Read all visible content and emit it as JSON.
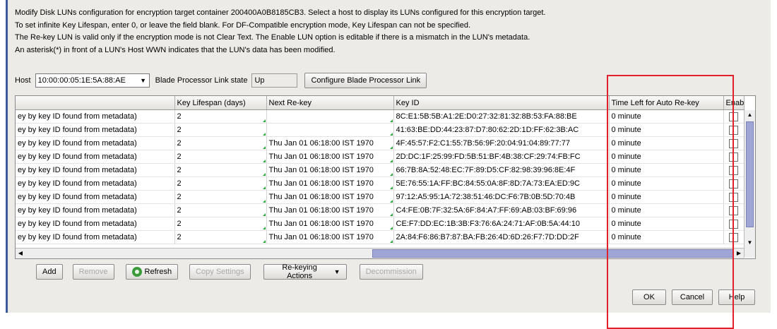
{
  "info_lines": [
    "Modify Disk LUNs configuration for encryption target container 200400A0B8185CB3. Select a host to display its LUNs configured for this encryption target.",
    "To set infinite Key Lifespan, enter 0, or leave the field blank. For DF-Compatible encryption mode, Key Lifespan can not be specified.",
    "The Re-key LUN is valid only if the encryption mode is not Clear Text. The Enable LUN option is editable if there is a mismatch in the LUN's metadata.",
    "An asterisk(*) in front of a LUN's Host WWN indicates that the LUN's data has been modified."
  ],
  "host": {
    "label": "Host",
    "value": "10:00:00:05:1E:5A:88:AE",
    "link_state_label": "Blade Processor Link state",
    "link_state_value": "Up",
    "configure_button": "Configure Blade Processor Link"
  },
  "table": {
    "columns": [
      "",
      "Key Lifespan (days)",
      "Next Re-key",
      "Key ID",
      "Time Left for Auto Re-key",
      "Enable"
    ],
    "rows": [
      {
        "c0": "ey by key ID found from metadata)",
        "c1": "2",
        "c2": "",
        "c3": "8C:E1:5B:5B:A1:2E:D0:27:32:81:32:8B:53:FA:88:BE",
        "c4": "0 minute"
      },
      {
        "c0": "ey by key ID found from metadata)",
        "c1": "2",
        "c2": "",
        "c3": "41:63:BE:DD:44:23:87:D7:80:62:2D:1D:FF:62:3B:AC",
        "c4": "0 minute"
      },
      {
        "c0": "ey by key ID found from metadata)",
        "c1": "2",
        "c2": "Thu Jan 01 06:18:00 IST 1970",
        "c3": "4F:45:57:F2:C1:55:7B:56:9F:20:04:91:04:89:77:77",
        "c4": "0 minute"
      },
      {
        "c0": "ey by key ID found from metadata)",
        "c1": "2",
        "c2": "Thu Jan 01 06:18:00 IST 1970",
        "c3": "2D:DC:1F:25:99:FD:5B:51:BF:4B:38:CF:29:74:FB:FC",
        "c4": "0 minute"
      },
      {
        "c0": "ey by key ID found from metadata)",
        "c1": "2",
        "c2": "Thu Jan 01 06:18:00 IST 1970",
        "c3": "66:7B:8A:52:48:EC:7F:89:D5:CF:82:98:39:96:8E:4F",
        "c4": "0 minute"
      },
      {
        "c0": "ey by key ID found from metadata)",
        "c1": "2",
        "c2": "Thu Jan 01 06:18:00 IST 1970",
        "c3": "5E:76:55:1A:FF:BC:84:55:0A:8F:8D:7A:73:EA:ED:9C",
        "c4": "0 minute"
      },
      {
        "c0": "ey by key ID found from metadata)",
        "c1": "2",
        "c2": "Thu Jan 01 06:18:00 IST 1970",
        "c3": "97:12:A5:95:1A:72:38:51:46:DC:F6:7B:0B:5D:70:4B",
        "c4": "0 minute"
      },
      {
        "c0": "ey by key ID found from metadata)",
        "c1": "2",
        "c2": "Thu Jan 01 06:18:00 IST 1970",
        "c3": "C4:FE:0B:7F:32:5A:6F:84:A7:FF:69:AB:03:BF:69:96",
        "c4": "0 minute"
      },
      {
        "c0": "ey by key ID found from metadata)",
        "c1": "2",
        "c2": "Thu Jan 01 06:18:00 IST 1970",
        "c3": "CE:F7:DD:EC:1B:3B:F3:76:6A:24:71:AF:0B:5A:44:10",
        "c4": "0 minute"
      },
      {
        "c0": "ey by key ID found from metadata)",
        "c1": "2",
        "c2": "Thu Jan 01 06:18:00 IST 1970",
        "c3": "2A:84:F6:86:B7:87:BA:FB:26:4D:6D:26:F7:7D:DD:2F",
        "c4": "0 minute"
      }
    ]
  },
  "actions": {
    "add": "Add",
    "remove": "Remove",
    "refresh": "Refresh",
    "copy_settings": "Copy Settings",
    "rekeying": "Re-keying Actions",
    "decommission": "Decommission"
  },
  "dialog_buttons": {
    "ok": "OK",
    "cancel": "Cancel",
    "help": "Help"
  },
  "colors": {
    "highlight_box": "#e0202a",
    "window_border": "#3d5a9a",
    "scroll_thumb": "#9fa6d6"
  }
}
